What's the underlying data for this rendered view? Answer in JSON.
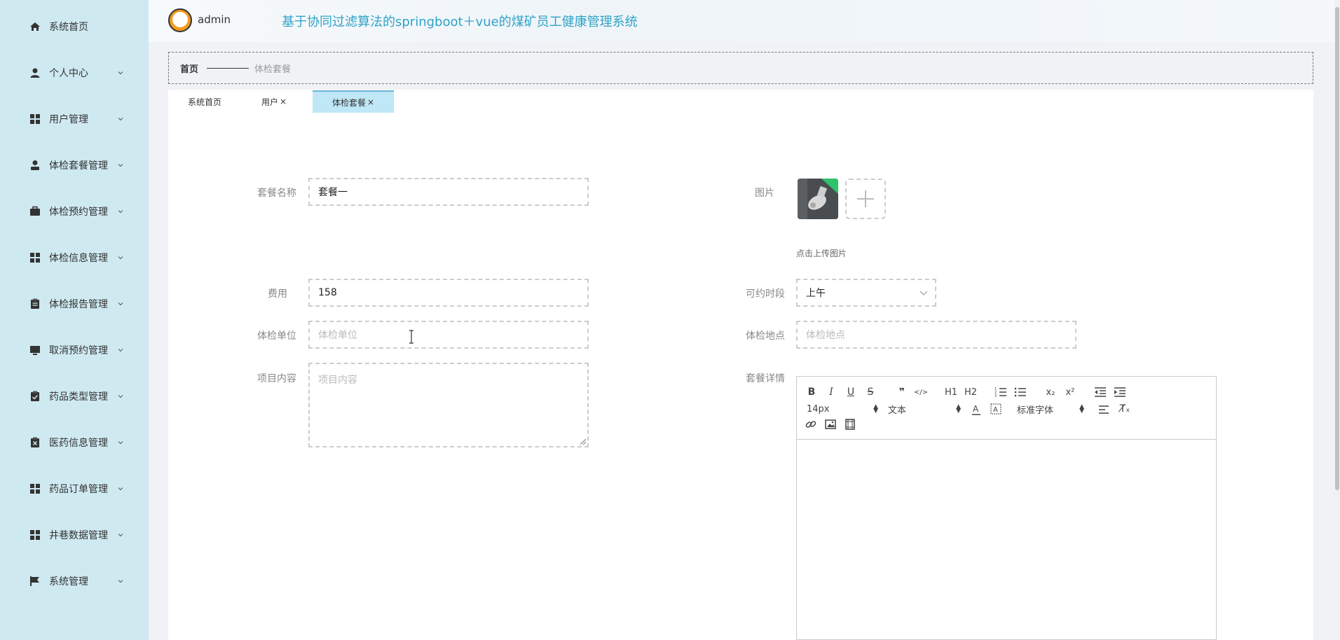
{
  "sidebar": {
    "items": [
      {
        "label": "系统首页",
        "icon": "home-icon",
        "has_arrow": false
      },
      {
        "label": "个人中心",
        "icon": "user-icon",
        "has_arrow": true
      },
      {
        "label": "用户管理",
        "icon": "grid-icon",
        "has_arrow": true
      },
      {
        "label": "体检套餐管理",
        "icon": "person-icon",
        "has_arrow": true
      },
      {
        "label": "体检预约管理",
        "icon": "briefcase-icon",
        "has_arrow": true
      },
      {
        "label": "体检信息管理",
        "icon": "grid-icon",
        "has_arrow": true
      },
      {
        "label": "体检报告管理",
        "icon": "clipboard-icon",
        "has_arrow": true
      },
      {
        "label": "取消预约管理",
        "icon": "monitor-icon",
        "has_arrow": true
      },
      {
        "label": "药品类型管理",
        "icon": "clipboard-check-icon",
        "has_arrow": true
      },
      {
        "label": "医药信息管理",
        "icon": "clipboard-x-icon",
        "has_arrow": true
      },
      {
        "label": "药品订单管理",
        "icon": "grid-icon",
        "has_arrow": true
      },
      {
        "label": "井巷数据管理",
        "icon": "grid-icon",
        "has_arrow": true
      },
      {
        "label": "系统管理",
        "icon": "flag-icon",
        "has_arrow": true
      }
    ]
  },
  "header": {
    "username": "admin",
    "title": "基于协同过滤算法的springboot＋vue的煤矿员工健康管理系统"
  },
  "breadcrumb": {
    "home": "首页",
    "current": "体检套餐"
  },
  "tabs": [
    {
      "label": "系统首页",
      "closable": false,
      "active": false
    },
    {
      "label": "用户",
      "closable": true,
      "active": false
    },
    {
      "label": "体检套餐",
      "closable": true,
      "active": true
    }
  ],
  "form": {
    "name": {
      "label": "套餐名称",
      "value": "套餐一"
    },
    "image": {
      "label": "图片",
      "hint": "点击上传图片"
    },
    "fee": {
      "label": "费用",
      "value": "158"
    },
    "slot": {
      "label": "可约时段",
      "value": "上午"
    },
    "unit": {
      "label": "体检单位",
      "placeholder": "体检单位"
    },
    "location": {
      "label": "体检地点",
      "placeholder": "体检地点"
    },
    "items": {
      "label": "项目内容",
      "placeholder": "项目内容"
    },
    "details": {
      "label": "套餐详情"
    }
  },
  "editor": {
    "font_size": "14px",
    "header_select": "文本",
    "font_family": "标准字体",
    "buttons": {
      "bold": "B",
      "italic": "I",
      "underline": "U",
      "strike": "S",
      "quote": "❞",
      "code": "</>",
      "h1": "H1",
      "h2": "H2",
      "subscript": "x₂",
      "superscript": "x²",
      "clean": "T̸ₓ"
    }
  },
  "colors": {
    "sidebar_bg": "#cfe9f1",
    "title_color": "#2fa3c6",
    "active_tab_bg": "#bfe7f6"
  }
}
